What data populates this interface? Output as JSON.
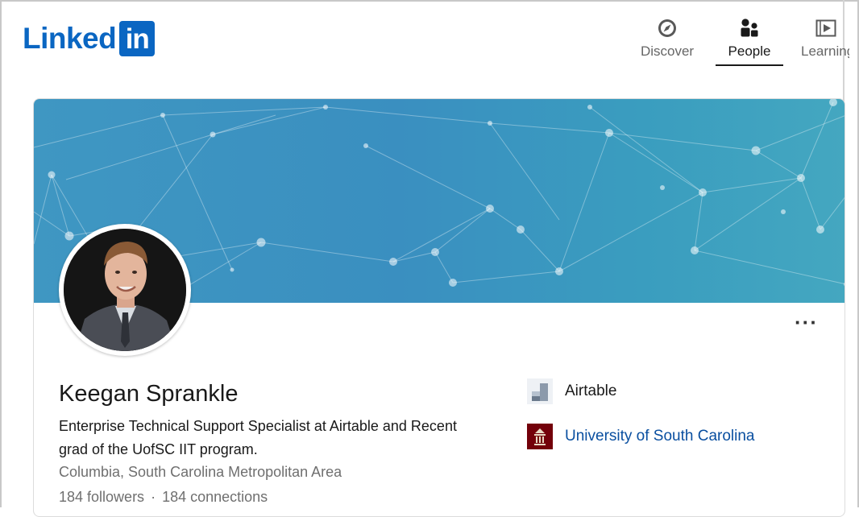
{
  "brand": {
    "logo_word": "Linked",
    "logo_box": "in"
  },
  "nav": {
    "items": [
      {
        "label": "Discover",
        "icon": "compass-icon",
        "active": false
      },
      {
        "label": "People",
        "icon": "people-icon",
        "active": true
      },
      {
        "label": "Learning",
        "icon": "video-icon",
        "active": false
      }
    ]
  },
  "profile": {
    "name": "Keegan Sprankle",
    "headline": "Enterprise Technical Support Specialist at Airtable and Recent grad of the UofSC IIT program.",
    "location": "Columbia, South Carolina Metropolitan Area",
    "followers": "184 followers",
    "separator": "·",
    "connections": "184 connections",
    "more_label": "···"
  },
  "organizations": [
    {
      "name": "Airtable",
      "icon": "airtable-logo-icon"
    },
    {
      "name": "University of South Carolina",
      "icon": "usc-logo-icon"
    }
  ],
  "colors": {
    "brand_blue": "#0a66c2",
    "banner": "#3f97c2",
    "link": "#0a4fa0"
  }
}
